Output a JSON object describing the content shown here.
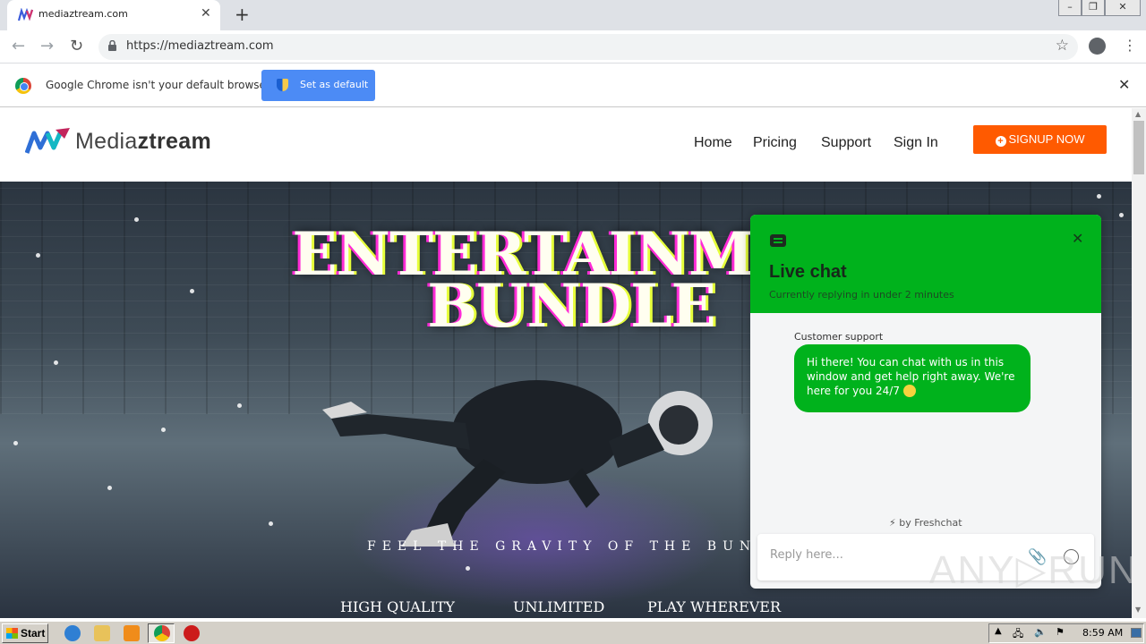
{
  "browser": {
    "tab_title": "mediaztream.com",
    "url": "https://mediaztream.com",
    "infobar_text": "Google Chrome isn't your default browser",
    "infobar_button": "Set as default"
  },
  "site": {
    "logo": {
      "light": "Media",
      "bold": "ztream"
    },
    "nav": [
      "Home",
      "Pricing",
      "Support",
      "Sign In"
    ],
    "signup_label": "SIGNUP NOW",
    "hero": {
      "title_line1": "ENTERTAINMEN",
      "title_line2": "BUNDLE",
      "subtitle": "FEEL THE GRAVITY OF THE BUNDLE",
      "features": [
        "HIGH QUALITY",
        "UNLIMITED",
        "PLAY WHEREVER"
      ]
    }
  },
  "chat": {
    "title": "Live chat",
    "status": "Currently replying in under 2 minutes",
    "sender": "Customer support",
    "message": "Hi there! You can chat with us in this window and get help right away. We're here for you 24/7",
    "powered_by": "⚡ by Freshchat",
    "input_placeholder": "Reply here...",
    "accent": "#00b21c"
  },
  "watermark": "ANY▷RUN",
  "taskbar": {
    "start_label": "Start",
    "clock": "8:59 AM"
  }
}
